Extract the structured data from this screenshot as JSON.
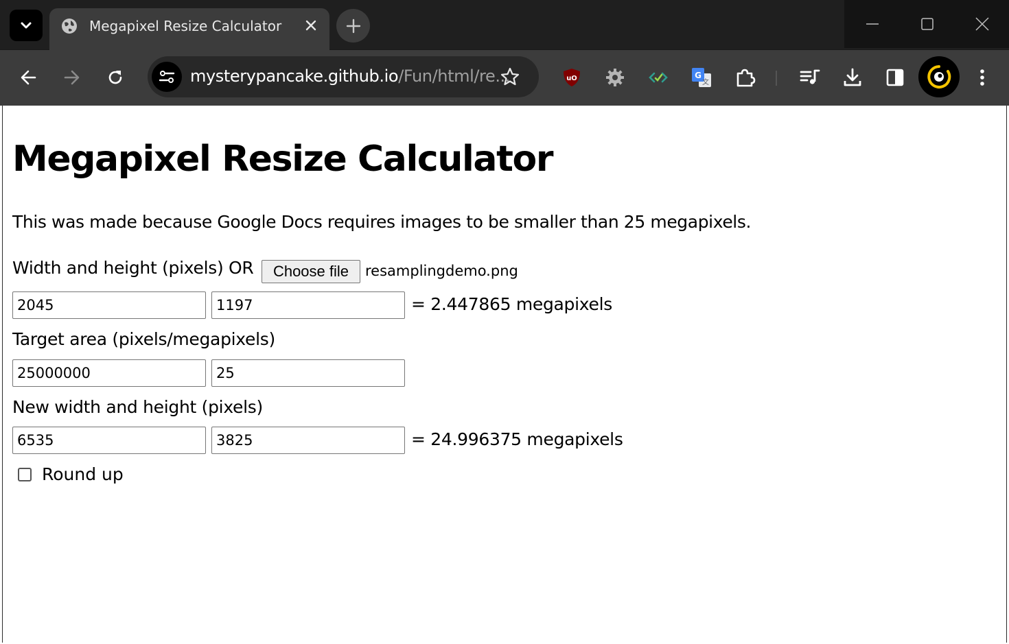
{
  "browser": {
    "tab_title": "Megapixel Resize Calculator",
    "url_host": "mysterypancake.github.io",
    "url_path": "/Fun/html/re...",
    "icons": [
      "tab-search-icon",
      "globe-icon",
      "close-icon",
      "plus-icon",
      "minimize-icon",
      "maximize-icon",
      "close-icon",
      "back-arrow-icon",
      "forward-arrow-icon",
      "reload-icon",
      "site-info-icon",
      "star-icon",
      "ublock-icon",
      "gear-icon",
      "extension-code-icon",
      "translate-icon",
      "puzzle-icon",
      "media-queue-icon",
      "download-icon",
      "side-panel-icon",
      "profile-icon",
      "more-vert-icon"
    ]
  },
  "page": {
    "title": "Megapixel Resize Calculator",
    "description": "This was made because Google Docs requires images to be smaller than 25 megapixels.",
    "input_label": "Width and height (pixels) OR",
    "choose_file_label": "Choose file",
    "file_name": "resamplingdemo.png",
    "width": "2045",
    "height": "1197",
    "input_result": "= 2.447865 megapixels",
    "target_label": "Target area (pixels/megapixels)",
    "target_pixels": "25000000",
    "target_megapixels": "25",
    "new_size_label": "New width and height (pixels)",
    "new_width": "6535",
    "new_height": "3825",
    "new_result": "= 24.996375 megapixels",
    "round_up_label": "Round up",
    "round_up_checked": false
  }
}
